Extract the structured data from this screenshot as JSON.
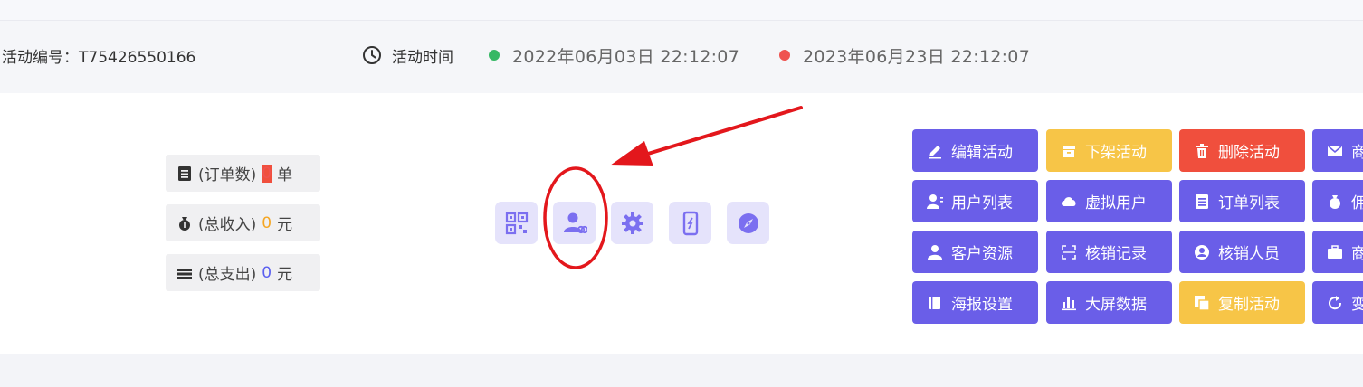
{
  "header": {
    "activity_id": "活动编号：T75426550166",
    "time_label": "活动时间",
    "start_time": "2022年06月03日 22:12:07",
    "end_time": "2023年06月23日 22:12:07"
  },
  "stats": [
    {
      "label": "(订单数)",
      "value": "0",
      "unit": "单",
      "icon": "clipboard-icon"
    },
    {
      "label": "(总收入)",
      "value": "0",
      "unit": "元",
      "icon": "money-bag-icon"
    },
    {
      "label": "(总支出)",
      "value": "0",
      "unit": "元",
      "icon": "stack-icon"
    }
  ],
  "quick_icons": [
    "qrcode-icon",
    "user-link-icon",
    "gear-icon",
    "mobile-icon",
    "compass-icon"
  ],
  "actions": [
    {
      "label": "编辑活动",
      "icon": "pencil-icon",
      "color": "#6a5ee8"
    },
    {
      "label": "下架活动",
      "icon": "archive-icon",
      "color": "#f7c547"
    },
    {
      "label": "删除活动",
      "icon": "trash-icon",
      "color": "#f04f3d"
    },
    {
      "label": "商",
      "icon": "envelope-icon",
      "color": "#6a5ee8"
    },
    {
      "label": "用户列表",
      "icon": "user-list-icon",
      "color": "#6a5ee8"
    },
    {
      "label": "虚拟用户",
      "icon": "cloud-icon",
      "color": "#6a5ee8"
    },
    {
      "label": "订单列表",
      "icon": "clipboard-icon",
      "color": "#6a5ee8"
    },
    {
      "label": "佣",
      "icon": "money-bag-icon",
      "color": "#6a5ee8"
    },
    {
      "label": "客户资源",
      "icon": "user-icon",
      "color": "#6a5ee8"
    },
    {
      "label": "核销记录",
      "icon": "scan-icon",
      "color": "#6a5ee8"
    },
    {
      "label": "核销人员",
      "icon": "user-circle-icon",
      "color": "#6a5ee8"
    },
    {
      "label": "商",
      "icon": "briefcase-icon",
      "color": "#6a5ee8"
    },
    {
      "label": "海报设置",
      "icon": "book-icon",
      "color": "#6a5ee8"
    },
    {
      "label": "大屏数据",
      "icon": "bar-chart-icon",
      "color": "#6a5ee8"
    },
    {
      "label": "复制活动",
      "icon": "copy-icon",
      "color": "#f7c547"
    },
    {
      "label": "变",
      "icon": "refresh-icon",
      "color": "#6a5ee8"
    }
  ]
}
